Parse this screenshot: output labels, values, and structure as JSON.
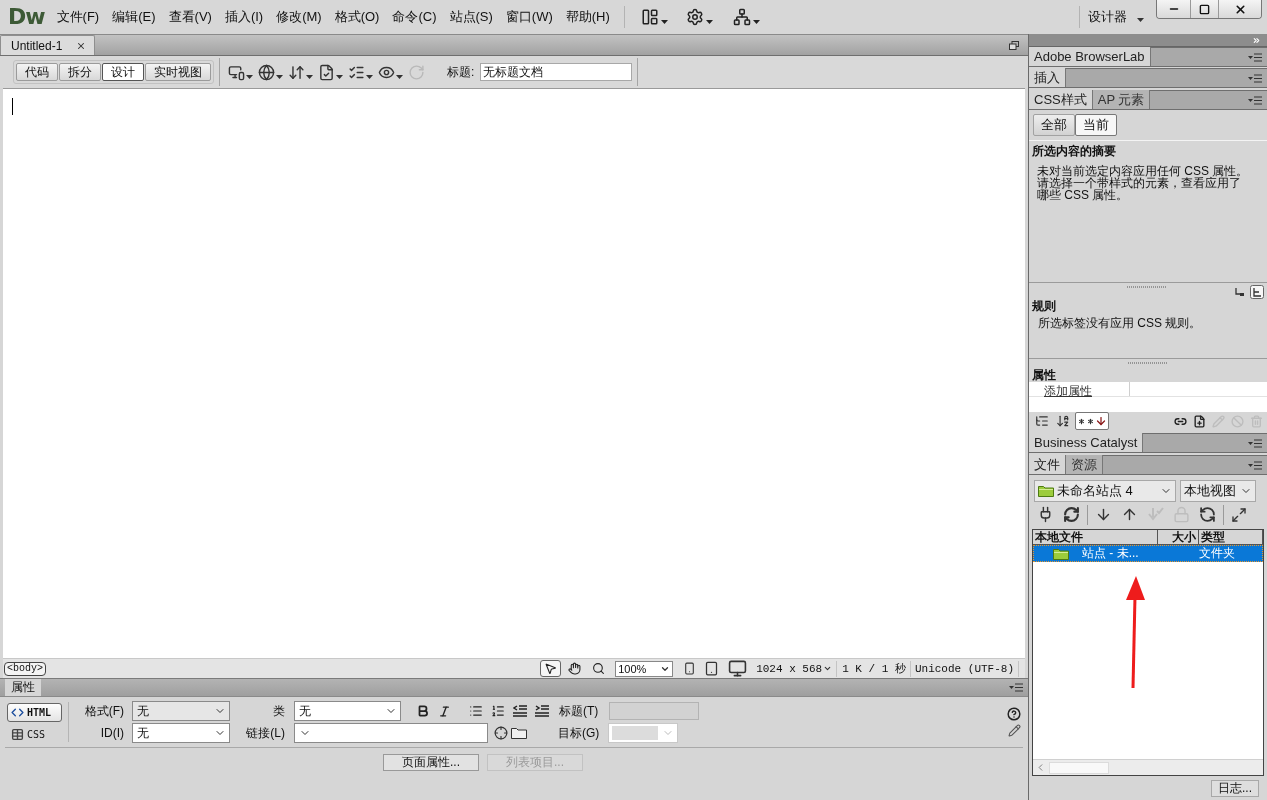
{
  "menu_bar": {
    "logo": "Dw",
    "menus": [
      "文件(F)",
      "编辑(E)",
      "查看(V)",
      "插入(I)",
      "修改(M)",
      "格式(O)",
      "命令(C)",
      "站点(S)",
      "窗口(W)",
      "帮助(H)"
    ],
    "workspace": "设计器"
  },
  "document_tabs": [
    {
      "label": "Untitled-1",
      "selected": true
    }
  ],
  "document_toolbar": {
    "views": [
      {
        "label": "代码",
        "selected": false
      },
      {
        "label": "拆分",
        "selected": false
      },
      {
        "label": "设计",
        "selected": true
      },
      {
        "label": "实时视图",
        "selected": false
      }
    ],
    "tools": [
      {
        "kind": "multiscreen",
        "disabled": false
      },
      {
        "kind": "preview",
        "disabled": false
      },
      {
        "kind": "file_management",
        "disabled": false
      },
      {
        "kind": "validate",
        "disabled": false
      },
      {
        "kind": "compatibility",
        "disabled": false
      },
      {
        "kind": "visual_aids",
        "disabled": false
      },
      {
        "kind": "refresh",
        "disabled": true
      }
    ],
    "title_label": "标题:",
    "title_value": "无标题文档"
  },
  "status_bar": {
    "tag": "<body>",
    "tools": [
      {
        "kind": "pointer",
        "selected": true
      },
      {
        "kind": "hand",
        "selected": false
      },
      {
        "kind": "zoom",
        "selected": false
      }
    ],
    "zoom": "100%",
    "window_size": "1024 x 568",
    "download": "1 K / 1 秒",
    "encoding": "Unicode (UTF-8)"
  },
  "properties_panel": {
    "tab": "属性",
    "modes": [
      {
        "kind": "html",
        "label": "HTML",
        "selected": true
      },
      {
        "kind": "css",
        "label": "CSS",
        "selected": false
      }
    ],
    "format": {
      "label": "格式(F)",
      "value": "无"
    },
    "id": {
      "label": "ID(I)",
      "value": "无"
    },
    "class": {
      "label": "类",
      "value": "无"
    },
    "link": {
      "label": "链接(L)"
    },
    "heading": {
      "label": "标题(T)",
      "disabled": true
    },
    "target": {
      "label": "目标(G)",
      "disabled": true
    },
    "buttons": [
      {
        "label": "页面属性...",
        "disabled": false
      },
      {
        "label": "列表项目...",
        "disabled": true
      }
    ]
  },
  "right_panel": {
    "collapsed_groups": [
      {
        "label": "Adobe BrowserLab"
      },
      {
        "label": "插入"
      }
    ],
    "css_styles": {
      "tabs": [
        {
          "label": "CSS样式",
          "selected": true
        },
        {
          "label": "AP 元素",
          "selected": false
        }
      ],
      "modes": [
        {
          "label": "全部",
          "selected": false
        },
        {
          "label": "当前",
          "selected": true
        }
      ],
      "summary_heading": "所选内容的摘要",
      "summary_text": "未对当前选定内容应用任何 CSS 属性。请选择一个带样式的元素，查看应用了哪些 CSS 属性。",
      "rules_views": [
        {
          "kind": "cascade",
          "selected": false
        },
        {
          "kind": "tree",
          "selected": true
        }
      ],
      "rules_heading": "规则",
      "rules_text": "所选标签没有应用 CSS 规则。",
      "properties_heading": "属性",
      "add_property": "添加属性",
      "views": [
        {
          "kind": "category_view",
          "selected": false
        },
        {
          "kind": "list_view",
          "selected": false
        },
        {
          "kind": "set_properties",
          "selected": true
        }
      ],
      "actions": [
        {
          "kind": "attach",
          "disabled": false
        },
        {
          "kind": "new_rule",
          "disabled": false
        },
        {
          "kind": "edit",
          "disabled": true
        },
        {
          "kind": "disable",
          "disabled": true
        },
        {
          "kind": "delete",
          "disabled": true
        }
      ]
    },
    "business_catalyst": {
      "label": "Business Catalyst"
    },
    "files": {
      "tabs": [
        {
          "label": "文件",
          "selected": true
        },
        {
          "label": "资源",
          "selected": false
        }
      ],
      "site": "未命名站点 4",
      "view": "本地视图",
      "tool_groups": [
        [
          {
            "kind": "connect",
            "disabled": false
          },
          {
            "kind": "refresh",
            "disabled": false
          }
        ],
        [
          {
            "kind": "get",
            "disabled": false
          },
          {
            "kind": "put",
            "disabled": false
          },
          {
            "kind": "check_out",
            "disabled": true
          },
          {
            "kind": "check_in",
            "disabled": true
          },
          {
            "kind": "synchronize",
            "disabled": false
          }
        ],
        [
          {
            "kind": "expand",
            "disabled": false
          }
        ]
      ],
      "columns": [
        "本地文件",
        "大小",
        "类型"
      ],
      "rows": [
        {
          "name": "站点 - 未...",
          "type": "文件夹",
          "selected": true
        }
      ],
      "log_button": "日志..."
    }
  }
}
